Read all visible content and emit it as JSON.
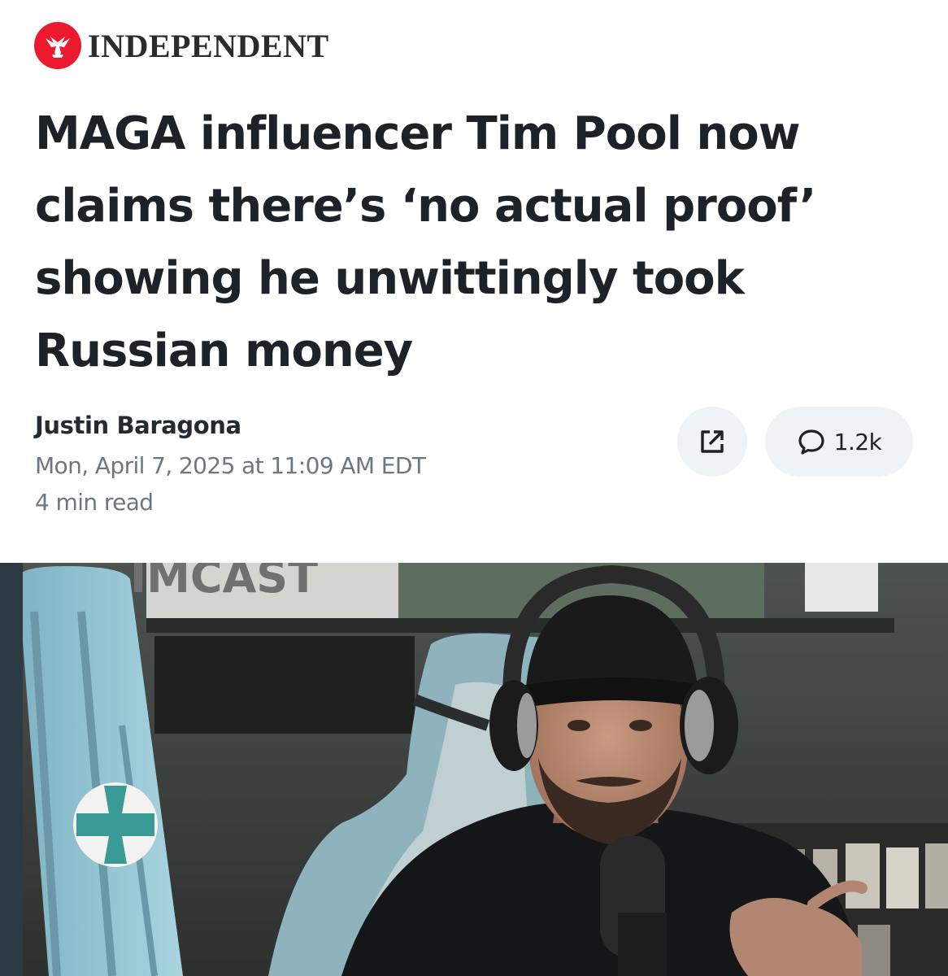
{
  "masthead": {
    "brand": "INDEPENDENT",
    "logo_icon": "eagle-icon",
    "brand_color": "#ec1a2e"
  },
  "article": {
    "headline": "MAGA influencer Tim Pool now claims there’s ‘no actual proof’ showing he unwittingly took Russian money",
    "author": "Justin Baragona",
    "date": "Mon, April 7, 2025 at 11:09 AM EDT",
    "read_time": "4 min read"
  },
  "actions": {
    "share_icon": "share-external-icon",
    "comment_icon": "comment-bubble-icon",
    "comment_count": "1.2k"
  },
  "hero": {
    "sign_text": "IMCAST"
  }
}
